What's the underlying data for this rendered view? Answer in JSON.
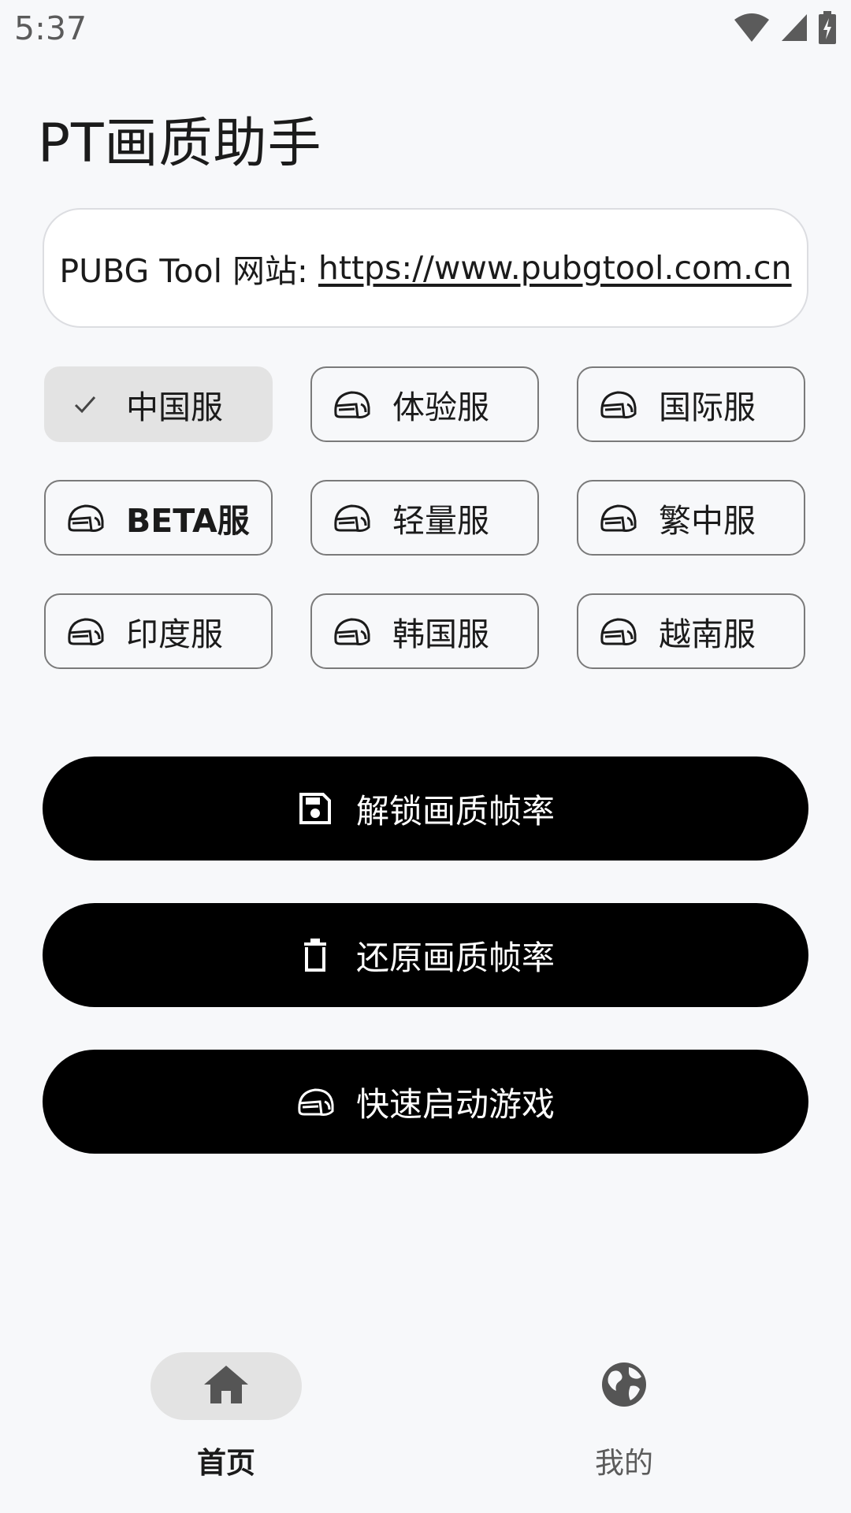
{
  "status_bar": {
    "time": "5:37",
    "icons": [
      "wifi-icon",
      "cell-signal-icon",
      "battery-charging-icon"
    ]
  },
  "app": {
    "title": "PT画质助手"
  },
  "website": {
    "prefix": "PUBG Tool 网站: ",
    "url": "https://www.pubgtool.com.cn"
  },
  "servers": [
    {
      "label": "中国服",
      "icon": "check-icon",
      "selected": true
    },
    {
      "label": "体验服",
      "icon": "helmet-icon",
      "selected": false
    },
    {
      "label": "国际服",
      "icon": "helmet-icon",
      "selected": false
    },
    {
      "label": "BETA服",
      "icon": "helmet-icon",
      "selected": false
    },
    {
      "label": "轻量服",
      "icon": "helmet-icon",
      "selected": false
    },
    {
      "label": "繁中服",
      "icon": "helmet-icon",
      "selected": false
    },
    {
      "label": "印度服",
      "icon": "helmet-icon",
      "selected": false
    },
    {
      "label": "韩国服",
      "icon": "helmet-icon",
      "selected": false
    },
    {
      "label": "越南服",
      "icon": "helmet-icon",
      "selected": false
    }
  ],
  "actions": {
    "unlock": {
      "label": "解锁画质帧率",
      "icon": "save-icon"
    },
    "restore": {
      "label": "还原画质帧率",
      "icon": "trash-icon"
    },
    "launch": {
      "label": "快速启动游戏",
      "icon": "helmet-icon"
    }
  },
  "nav": {
    "home": {
      "label": "首页",
      "icon": "home-icon",
      "active": true
    },
    "mine": {
      "label": "我的",
      "icon": "globe-icon",
      "active": false
    }
  },
  "colors": {
    "background": "#f7f8fa",
    "primary_button": "#000000",
    "selected_chip": "#e3e3e3",
    "chip_border": "#7a7a7a"
  }
}
